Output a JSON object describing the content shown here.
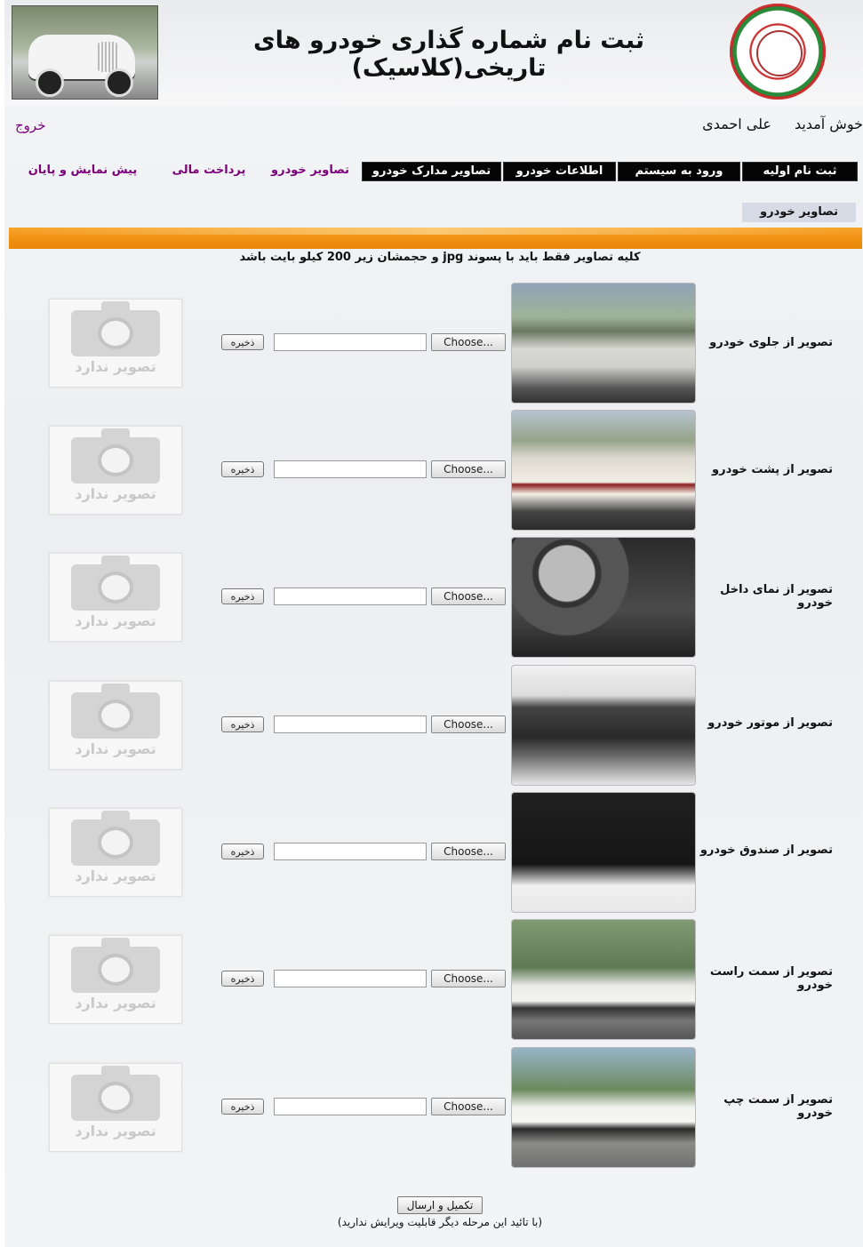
{
  "header": {
    "title": "ثبت نام شماره گذاری خودرو های تاریخی(کلاسیک)"
  },
  "user": {
    "welcome": "خوش آمدید",
    "name": "علی احمدی",
    "logout": "خروج"
  },
  "nav": {
    "items": [
      {
        "label": "ثبت نام اولیه",
        "style": "dark"
      },
      {
        "label": "ورود به سیستم",
        "style": "dark"
      },
      {
        "label": "اطلاعات خودرو",
        "style": "dark"
      },
      {
        "label": "تصاویر مدارک خودرو",
        "style": "dark"
      },
      {
        "label": "تصاویر خودرو",
        "style": "link"
      },
      {
        "label": "پرداخت مالی",
        "style": "link"
      },
      {
        "label": "پیش نمایش و پایان",
        "style": "link"
      }
    ]
  },
  "subtab": "تصاویر خودرو",
  "notice": "کلیه تصاویر فقط باید با پسوند jpg و حجمشان زیر 200 کیلو بایت باشد",
  "colors": {
    "accent": "#ef8f10",
    "nav_dark": "#050505",
    "link": "#7a007a",
    "subtab": "#d6dbe6"
  },
  "rows": [
    {
      "label": "تصویر از جلوی خودرو",
      "choose": "Choose...",
      "save": "ذخیره",
      "noimg": "تصویر ندارد"
    },
    {
      "label": "تصویر از پشت خودرو",
      "choose": "Choose...",
      "save": "ذخیره",
      "noimg": "تصویر ندارد"
    },
    {
      "label": "تصویر از نمای داخل خودرو",
      "choose": "Choose...",
      "save": "ذخیره",
      "noimg": "تصویر ندارد"
    },
    {
      "label": "تصویر از موتور خودرو",
      "choose": "Choose...",
      "save": "ذخیره",
      "noimg": "تصویر ندارد"
    },
    {
      "label": "تصویر از صندوق خودرو",
      "choose": "Choose...",
      "save": "ذخیره",
      "noimg": "تصویر ندارد"
    },
    {
      "label": "تصویر از سمت راست خودرو",
      "choose": "Choose...",
      "save": "ذخیره",
      "noimg": "تصویر ندارد"
    },
    {
      "label": "تصویر از سمت چپ خودرو",
      "choose": "Choose...",
      "save": "ذخیره",
      "noimg": "تصویر ندارد"
    }
  ],
  "submit": {
    "label": "تکمیل و ارسال",
    "note": "(با تائید این مرحله دیگر قابلیت ویرایش ندارید)"
  }
}
